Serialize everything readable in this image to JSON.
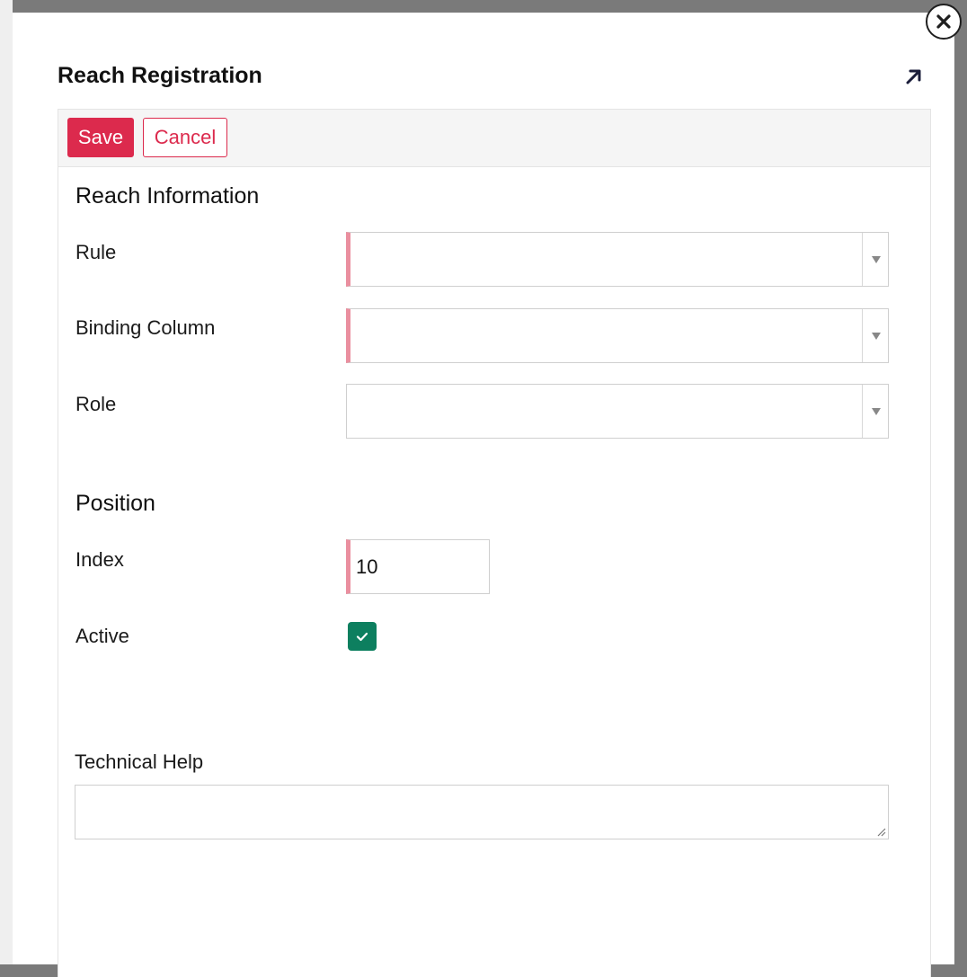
{
  "dialog": {
    "title": "Reach Registration",
    "close_icon": "close-icon",
    "expand_icon": "expand-arrow-icon"
  },
  "toolbar": {
    "save_label": "Save",
    "cancel_label": "Cancel"
  },
  "reach_information": {
    "heading": "Reach Information",
    "fields": [
      {
        "label": "Rule",
        "value": "",
        "required": true
      },
      {
        "label": "Binding Column",
        "value": "",
        "required": true
      },
      {
        "label": "Role",
        "value": "",
        "required": false
      }
    ]
  },
  "position": {
    "heading": "Position",
    "index_label": "Index",
    "index_value": "10",
    "active_label": "Active",
    "active_checked": true
  },
  "technical_help": {
    "label": "Technical Help",
    "value": ""
  },
  "colors": {
    "accent": "#dc2a4d",
    "required_marker": "#ea8f9f",
    "checkbox": "#0d7f5f"
  }
}
